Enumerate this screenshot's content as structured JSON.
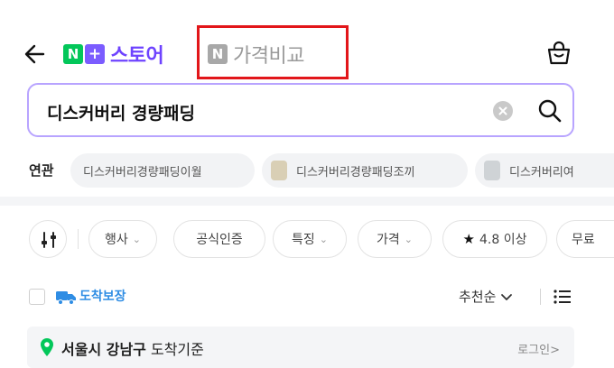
{
  "header": {
    "logo_n": "N",
    "logo_plus": "+",
    "store_label": "스토어",
    "compare_n": "N",
    "compare_label": "가격비교",
    "brand_color": "#03c75a",
    "store_color": "#6e43ff",
    "highlight_color": "#e2161a"
  },
  "search": {
    "query": "디스커버리 경량패딩"
  },
  "related": {
    "label": "연관",
    "items": [
      "디스커버리경량패딩이월",
      "디스커버리경량패딩조끼",
      "디스커버리여"
    ]
  },
  "filters": {
    "chips": [
      "행사",
      "공식인증",
      "특징",
      "가격",
      "4.8 이상",
      "무료"
    ],
    "star": "★"
  },
  "toolbar": {
    "delivery_label": "도착보장",
    "sort_label": "추천순",
    "sort_caret": "⌄"
  },
  "location": {
    "city": "서울시 강남구",
    "suffix": " 도착기준",
    "login": "로그인>"
  }
}
